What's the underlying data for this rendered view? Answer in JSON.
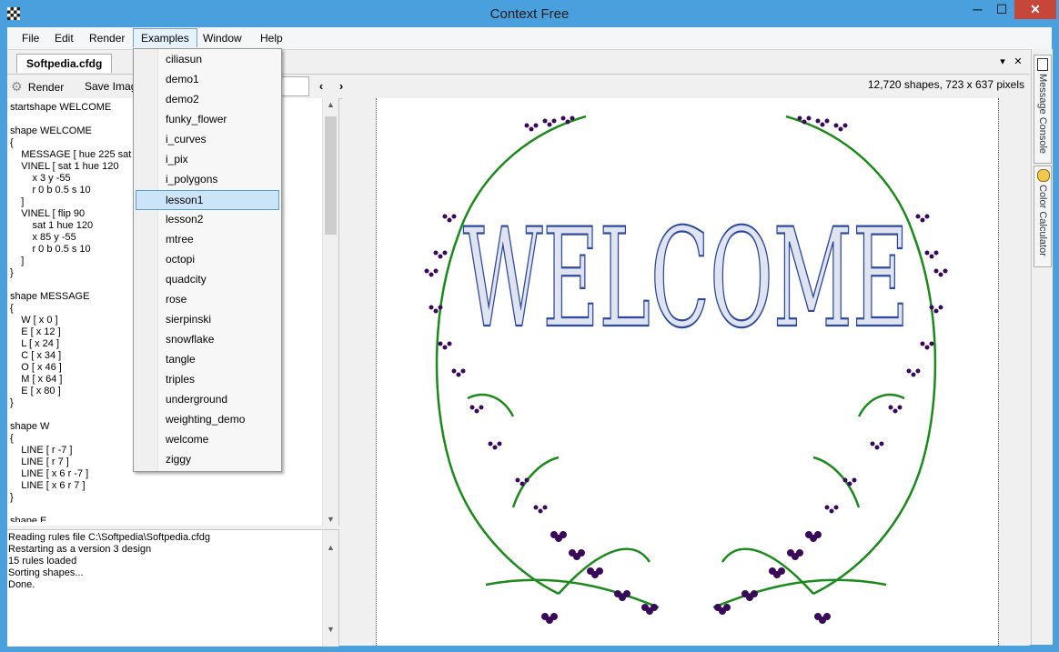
{
  "window": {
    "title": "Context Free",
    "min_label": "─",
    "max_label": "☐",
    "close_label": "✕"
  },
  "menubar": {
    "items": [
      "File",
      "Edit",
      "Render",
      "Examples",
      "Window",
      "Help"
    ],
    "open_menu": "Examples"
  },
  "tab": {
    "label": "Softpedia.cfdg",
    "dropdown_glyph": "▾",
    "close_glyph": "✕"
  },
  "toolbar": {
    "render_label": "Render",
    "save_label": "Save Imag",
    "status": "12,720 shapes, 723 x 637 pixels"
  },
  "editor": {
    "lines": [
      "startshape WELCOME",
      "",
      "shape WELCOME",
      "{",
      "    MESSAGE [ hue 225 sat",
      "    VINEL [ sat 1 hue 120",
      "        x 3 y -55",
      "        r 0 b 0.5 s 10",
      "    ]",
      "    VINEL [ flip 90",
      "        sat 1 hue 120",
      "        x 85 y -55",
      "        r 0 b 0.5 s 10",
      "    ]",
      "}",
      "",
      "shape MESSAGE",
      "{",
      "    W [ x 0 ]",
      "    E [ x 12 ]",
      "    L [ x 24 ]",
      "    C [ x 34 ]",
      "    O [ x 46 ]",
      "    M [ x 64 ]",
      "    E [ x 80 ]",
      "}",
      "",
      "shape W",
      "{",
      "    LINE [ r -7 ]",
      "    LINE [ r 7 ]",
      "    LINE [ x 6 r -7 ]",
      "    LINE [ x 6 r 7 ]",
      "}",
      "",
      "shape E"
    ]
  },
  "console": {
    "lines": [
      "Reading rules file C:\\Softpedia\\Softpedia.cfdg",
      "Restarting as a version 3 design",
      "15 rules loaded",
      "Sorting shapes...",
      "Done."
    ]
  },
  "examples_menu": {
    "items": [
      "ciliasun",
      "demo1",
      "demo2",
      "funky_flower",
      "i_curves",
      "i_pix",
      "i_polygons",
      "lesson1",
      "lesson2",
      "mtree",
      "octopi",
      "quadcity",
      "rose",
      "sierpinski",
      "snowflake",
      "tangle",
      "triples",
      "underground",
      "weighting_demo",
      "welcome",
      "ziggy"
    ],
    "highlighted": "lesson1"
  },
  "side_panel": {
    "message_console_label": "Message Console",
    "color_calculator_label": "Color Calculator"
  },
  "canvas": {
    "word": "WELCOME",
    "text_color": "#2e4aa0",
    "vine_color": "#1a8a1a",
    "berry_color": "#3a0a5a"
  }
}
